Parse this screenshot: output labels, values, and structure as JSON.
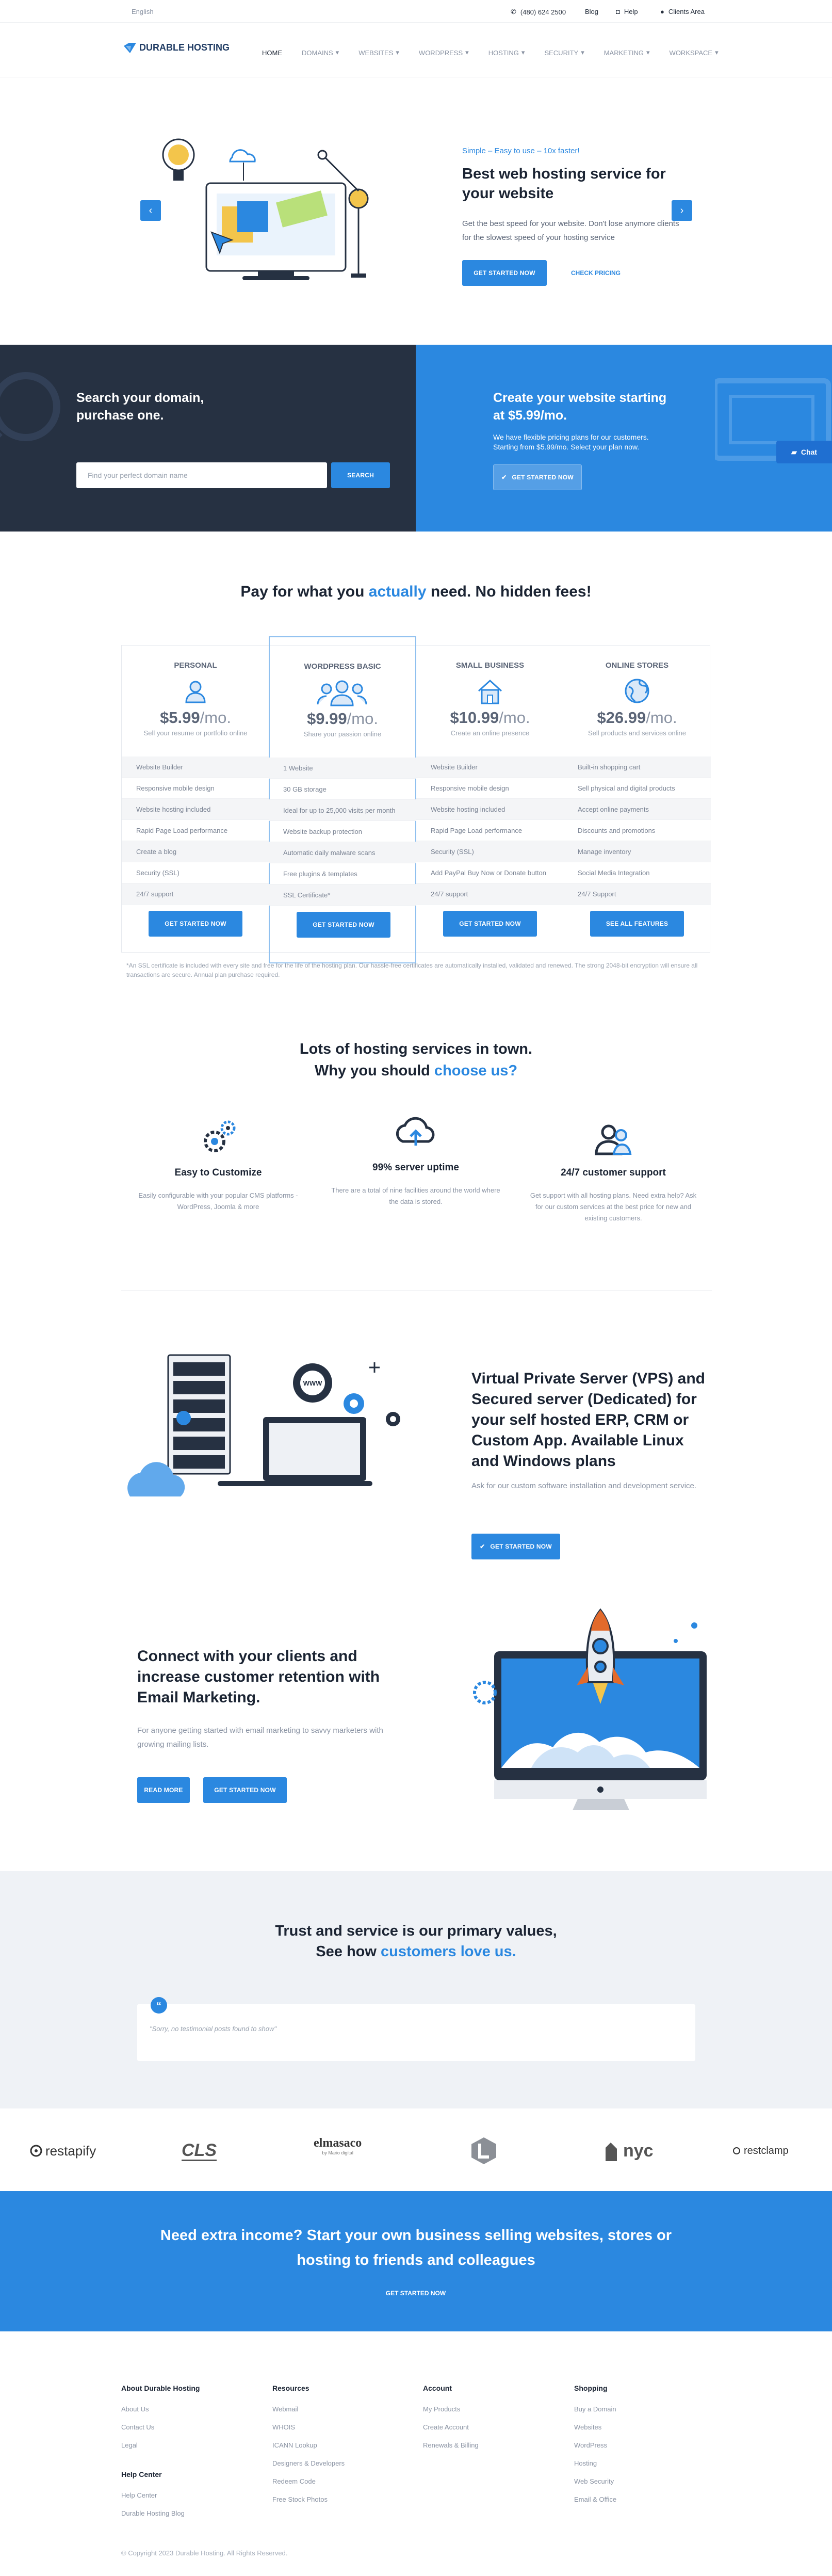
{
  "topbar": {
    "language": "English",
    "phone": "(480) 624 2500",
    "blog": "Blog",
    "help": "Help",
    "clients_area": "Clients Area"
  },
  "nav": {
    "logo": "DURABLE HOSTING",
    "items": [
      {
        "label": "HOME"
      },
      {
        "label": "DOMAINS"
      },
      {
        "label": "WEBSITES"
      },
      {
        "label": "WORDPRESS"
      },
      {
        "label": "HOSTING"
      },
      {
        "label": "SECURITY"
      },
      {
        "label": "MARKETING"
      },
      {
        "label": "WORKSPACE"
      }
    ]
  },
  "hero": {
    "kicker": "Simple – Easy to use – 10x faster!",
    "title": "Best web hosting service for your website",
    "description": "Get the best speed for your website. Don't lose anymore clients for the slowest speed of your hosting service",
    "cta_primary": "GET STARTED NOW",
    "cta_secondary": "CHECK PRICING"
  },
  "domain": {
    "title": "Search your domain, purchase one.",
    "placeholder": "Find your perfect domain name",
    "button": "SEARCH"
  },
  "promo": {
    "title": "Create your website starting at $5.99/mo.",
    "text": "We have flexible pricing plans for our customers. Starting from $5.99/mo. Select your plan now.",
    "button": "GET STARTED NOW",
    "chat": "Chat"
  },
  "pricing": {
    "title_pre": "Pay for what you ",
    "title_accent": "actually",
    "title_post": " need. No hidden fees!",
    "plans": [
      {
        "name": "PERSONAL",
        "price": "$5.99",
        "per": "/mo.",
        "subtitle": "Sell your resume or portfolio online",
        "features": [
          "Website Builder",
          "Responsive mobile design",
          "Website hosting included",
          "Rapid Page Load performance",
          "Create a blog",
          "Security (SSL)",
          "24/7 support"
        ],
        "button": "GET STARTED NOW"
      },
      {
        "name": "WORDPRESS BASIC",
        "price": "$9.99",
        "per": "/mo.",
        "subtitle": "Share your passion online",
        "features": [
          "1 Website",
          "30 GB storage",
          "Ideal for up to 25,000 visits per month",
          "Website backup protection",
          "Automatic daily malware scans",
          "Free plugins & templates",
          "SSL Certificate*"
        ],
        "button": "GET STARTED NOW"
      },
      {
        "name": "SMALL BUSINESS",
        "price": "$10.99",
        "per": "/mo.",
        "subtitle": "Create an online presence",
        "features": [
          "Website Builder",
          "Responsive mobile design",
          "Website hosting included",
          "Rapid Page Load performance",
          "Security (SSL)",
          "Add PayPal Buy Now or Donate button",
          "24/7 support"
        ],
        "button": "GET STARTED NOW"
      },
      {
        "name": "ONLINE STORES",
        "price": "$26.99",
        "per": "/mo.",
        "subtitle": "Sell products and services online",
        "features": [
          "Built-in shopping cart",
          "Sell physical and digital products",
          "Accept online payments",
          "Discounts and promotions",
          "Manage inventory",
          "Social Media Integration",
          "24/7 Support"
        ],
        "button": "SEE ALL FEATURES"
      }
    ],
    "note": "*An SSL certificate is included with every site and free for the life of the hosting plan. Our hassle-free certificates are automatically installed, validated and renewed. The strong 2048-bit encryption will ensure all transactions are secure. Annual plan purchase required."
  },
  "why": {
    "line1": "Lots of hosting services in town.",
    "line2_pre": "Why you should ",
    "line2_accent": "choose us?",
    "features": [
      {
        "title": "Easy to Customize",
        "text": "Easily configurable with your popular CMS platforms - WordPress, Joomla & more"
      },
      {
        "title": "99% server uptime",
        "text": "There are a total of nine facilities around the world where the data is stored."
      },
      {
        "title": "24/7 customer support",
        "text": "Get support with all hosting plans. Need extra help? Ask for our custom services at the best price for new and existing customers."
      }
    ]
  },
  "vps": {
    "title": "Virtual Private Server (VPS) and Secured server (Dedicated) for your self hosted ERP, CRM or Custom App. Available Linux and Windows plans",
    "text": "Ask for our custom software installation and development service.",
    "button": "GET STARTED NOW",
    "illus_label": "WWW"
  },
  "email": {
    "title": "Connect with your clients and increase customer retention with Email Marketing.",
    "text": "For anyone getting started with email marketing to savvy marketers with growing mailing lists.",
    "button1": "READ MORE",
    "button2": "GET STARTED NOW"
  },
  "testimonials": {
    "line1": "Trust and service is our primary values,",
    "line2_pre": "See how ",
    "line2_accent": "customers love us.",
    "empty": "\"Sorry, no testimonial posts found to show\""
  },
  "logos": [
    {
      "name": "restapify"
    },
    {
      "name": "CLS"
    },
    {
      "name": "elmasaco",
      "sub": "by Mario digital"
    },
    {
      "name": "nyc"
    },
    {
      "name": "restclamp"
    }
  ],
  "cta": {
    "line1": "Need extra income? Start your own business selling websites, stores or",
    "line2": "hosting to friends and colleagues",
    "button": "GET STARTED NOW"
  },
  "footer": {
    "columns": [
      {
        "title": "About Durable Hosting",
        "links": [
          "About Us",
          "Contact Us",
          "Legal"
        ]
      },
      {
        "title": "Resources",
        "links": [
          "Webmail",
          "WHOIS",
          "ICANN Lookup",
          "Designers & Developers",
          "Redeem Code",
          "Free Stock Photos"
        ]
      },
      {
        "title": "Account",
        "links": [
          "My Products",
          "Create Account",
          "Renewals & Billing"
        ]
      },
      {
        "title": "Shopping",
        "links": [
          "Buy a Domain",
          "Websites",
          "WordPress",
          "Hosting",
          "Web Security",
          "Email & Office"
        ]
      }
    ],
    "help_title": "Help Center",
    "help_links": [
      "Help Center",
      "Durable Hosting Blog"
    ],
    "copyright": "© Copyright 2023 Durable Hosting. All Rights Reserved."
  },
  "colors": {
    "accent": "#2b88e0",
    "dark": "#263142",
    "heading": "#1b2433"
  }
}
